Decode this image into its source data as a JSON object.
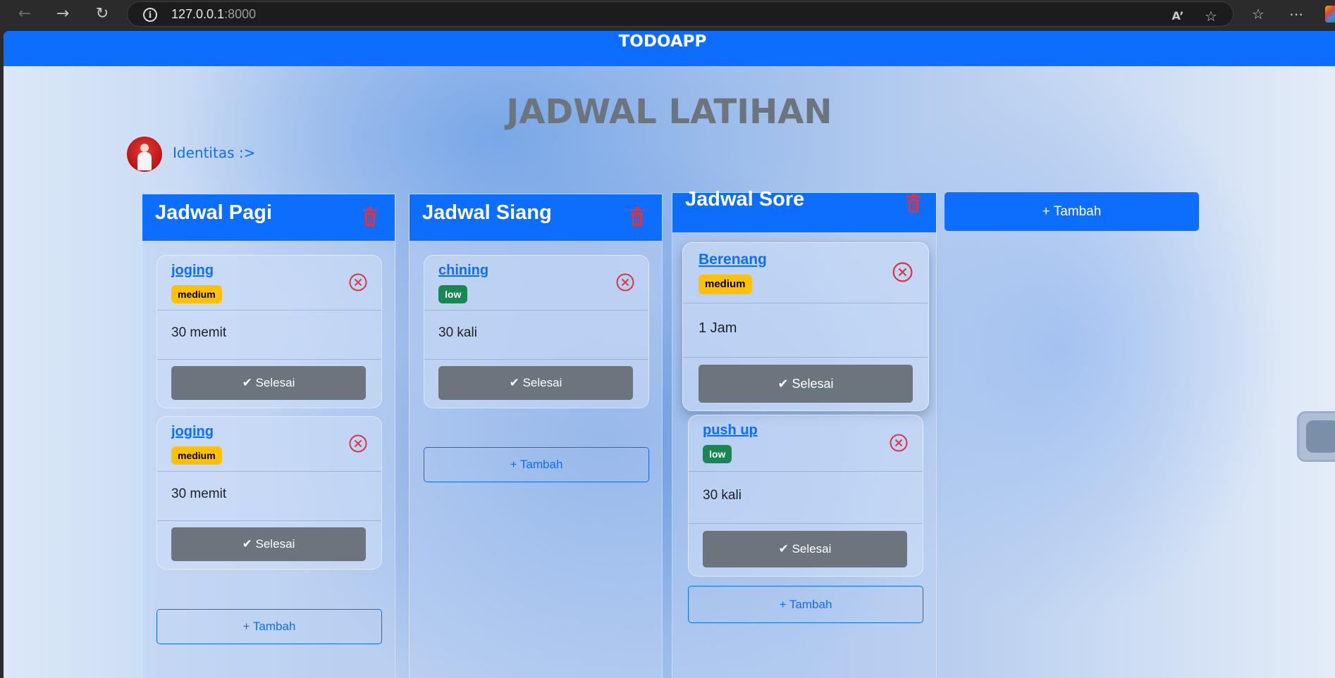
{
  "browser": {
    "url_host": "127.0.0.1",
    "url_port": ":8000"
  },
  "app": {
    "brand": "TODOAPP",
    "page_title": "JADWAL LATIHAN",
    "identitas_link": "Identitas :>",
    "add_column_label": "+ Tambah"
  },
  "colors": {
    "primary": "#0d6efd",
    "danger": "#dc3545",
    "secondary": "#6c757d",
    "warning": "#ffc107",
    "success": "#198754"
  },
  "columns": [
    {
      "title": "Jadwal Pagi",
      "add_label": "+ Tambah",
      "cards": [
        {
          "title": "joging",
          "priority": "medium",
          "body": "30 memit",
          "done_label": "Selesai"
        },
        {
          "title": "joging",
          "priority": "medium",
          "body": "30 memit",
          "done_label": "Selesai"
        }
      ]
    },
    {
      "title": "Jadwal Siang",
      "add_label": "+ Tambah",
      "cards": [
        {
          "title": "chining",
          "priority": "low",
          "body": "30 kali",
          "done_label": "Selesai"
        }
      ]
    },
    {
      "title": "Jadwal Sore",
      "add_label": "+ Tambah",
      "cards": [
        {
          "title": "Berenang",
          "priority": "medium",
          "body": "1 Jam",
          "done_label": "Selesai"
        },
        {
          "title": "push up",
          "priority": "low",
          "body": "30 kali",
          "done_label": "Selesai"
        }
      ]
    }
  ]
}
